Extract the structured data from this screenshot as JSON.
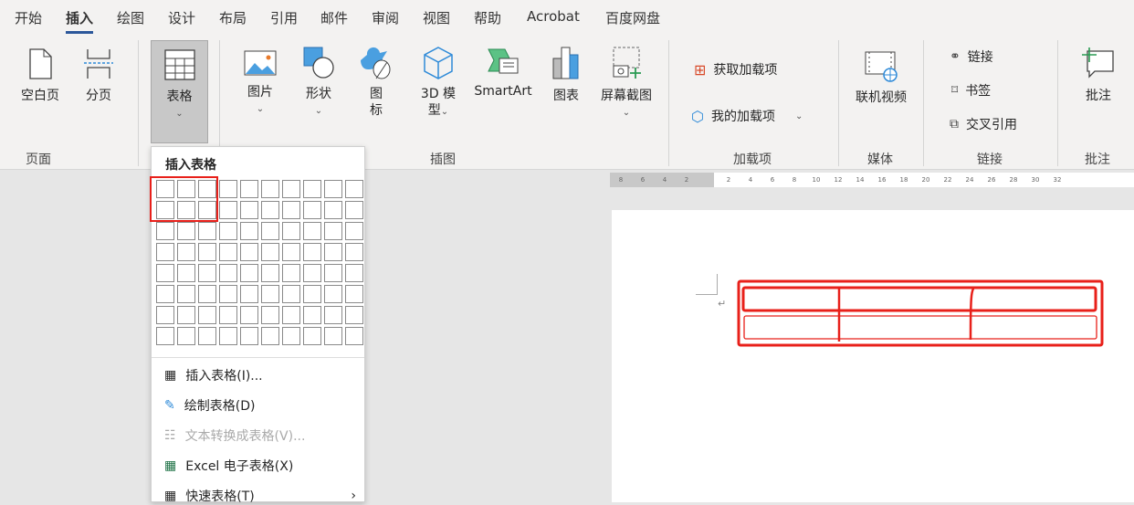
{
  "tabs": [
    "开始",
    "插入",
    "绘图",
    "设计",
    "布局",
    "引用",
    "邮件",
    "审阅",
    "视图",
    "帮助",
    "Acrobat",
    "百度网盘"
  ],
  "active_tab": "插入",
  "ribbon": {
    "page_group": {
      "label": "页面",
      "blank_page": "空白页",
      "page_break": "分页"
    },
    "table_button": "表格",
    "illustrations": {
      "label": "插图",
      "pictures": "图片",
      "shapes": "形状",
      "icons": "图标",
      "model3d": "3D 模型",
      "smartart": "SmartArt",
      "chart": "图表",
      "screenshot": "屏幕截图"
    },
    "addins": {
      "label": "加载项",
      "get": "获取加载项",
      "mine": "我的加载项"
    },
    "media": {
      "label": "媒体",
      "online_video": "联机视频"
    },
    "links": {
      "label": "链接",
      "link": "链接",
      "bookmark": "书签",
      "cross_ref": "交叉引用"
    },
    "comments": {
      "label": "批注",
      "comment": "批注"
    }
  },
  "ruler": [
    "8",
    "6",
    "4",
    "2",
    "",
    "2",
    "4",
    "6",
    "8",
    "10",
    "12",
    "14",
    "16",
    "18",
    "20",
    "22",
    "24",
    "26",
    "28",
    "30",
    "32"
  ],
  "menu": {
    "title": "插入表格",
    "grid": {
      "cols": 10,
      "rows": 8,
      "selected_cols": 3,
      "selected_rows": 2
    },
    "items": [
      {
        "label": "插入表格(I)...",
        "disabled": false
      },
      {
        "label": "绘制表格(D)",
        "disabled": false
      },
      {
        "label": "文本转换成表格(V)...",
        "disabled": true
      },
      {
        "label": "Excel 电子表格(X)",
        "disabled": false
      },
      {
        "label": "快速表格(T)",
        "disabled": false
      }
    ]
  },
  "colors": {
    "accent": "#2b579a",
    "highlight": "#e8201a"
  }
}
